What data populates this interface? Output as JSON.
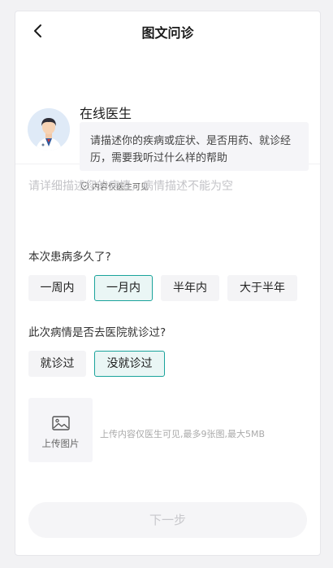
{
  "header": {
    "title": "图文问诊"
  },
  "doctor": {
    "name": "在线医生",
    "prompt": "请描述你的疾病或症状、是否用药、就诊经历，需要我听过什么样的帮助",
    "prompt_line1": "请描述你的疾病或症状、是否用药、就诊经",
    "prompt_line2": "历，需要我听过什么样的帮助",
    "privacy_note": "内容仅医生可见"
  },
  "description": {
    "placeholder": "请详细描述您的病情，病情描述不能为空",
    "value": ""
  },
  "duration": {
    "question": "本次患病多久了?",
    "options": [
      "一周内",
      "一月内",
      "半年内",
      "大于半年"
    ],
    "selected": "一月内"
  },
  "visited": {
    "question": "此次病情是否去医院就诊过?",
    "options": [
      "就诊过",
      "没就诊过"
    ],
    "selected": "没就诊过"
  },
  "upload": {
    "label": "上传图片",
    "hint": "上传内容仅医生可见,最多9张图,最大5MB"
  },
  "next_button": {
    "label": "下一步"
  },
  "colors": {
    "accent": "#1aa39b",
    "selected_bg": "#eaf6f5",
    "option_bg": "#f4f4f6"
  },
  "icons": {
    "back": "chevron-left-icon",
    "privacy": "shield-check-icon",
    "upload": "image-icon"
  }
}
